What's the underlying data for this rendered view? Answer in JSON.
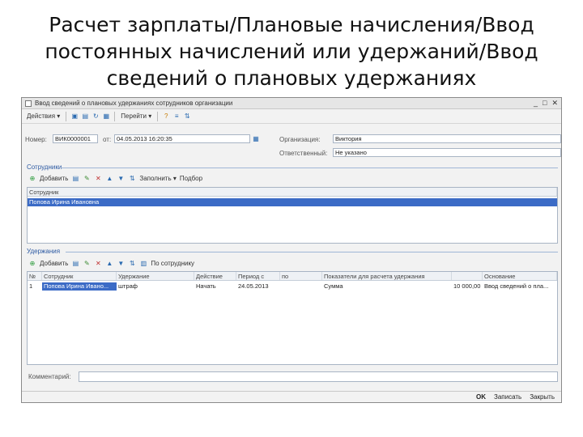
{
  "slide": {
    "title_lines": [
      "Расчет зарплаты/Плановые начисления/Ввод",
      "постоянных начислений или удержаний/Ввод",
      "сведений о плановых удержаниях"
    ]
  },
  "window": {
    "title": "Ввод сведений о плановых удержаниях сотрудников организации",
    "controls": [
      "_",
      "□",
      "✕"
    ]
  },
  "toolbar": {
    "actions_label": "Действия ▾",
    "goto_label": "Перейти ▾"
  },
  "header": {
    "number_label": "Номер:",
    "number_value": "ВИК0000001",
    "date_label": "от:",
    "date_value": "04.05.2013 16:20:35",
    "org_label": "Организация:",
    "org_value": "Виктория",
    "resp_label": "Ответственный:",
    "resp_value": "Не указано"
  },
  "employees": {
    "section_label": "Сотрудники",
    "add_label": "Добавить",
    "fill_label": "Заполнить ▾",
    "select_label": "Подбор",
    "column": "Сотрудник",
    "rows": [
      "Попова Ирина Ивановна"
    ]
  },
  "deductions": {
    "section_label": "Удержания",
    "add_label": "Добавить",
    "by_employee_label": "По сотруднику",
    "columns": [
      "№",
      "Сотрудник",
      "Удержание",
      "Действие",
      "Период с",
      "по",
      "Показатели для расчета удержания",
      "",
      "Основание"
    ],
    "rows": [
      [
        "1",
        "Попова Ирина Ивано...",
        "штраф",
        "Начать",
        "24.05.2013",
        "",
        "Сумма",
        "10 000,00",
        "Ввод сведений о пла..."
      ]
    ]
  },
  "footer": {
    "comment_label": "Комментарий:",
    "comment_value": "",
    "ok_label": "OK",
    "write_label": "Записать",
    "close_label": "Закрыть"
  }
}
